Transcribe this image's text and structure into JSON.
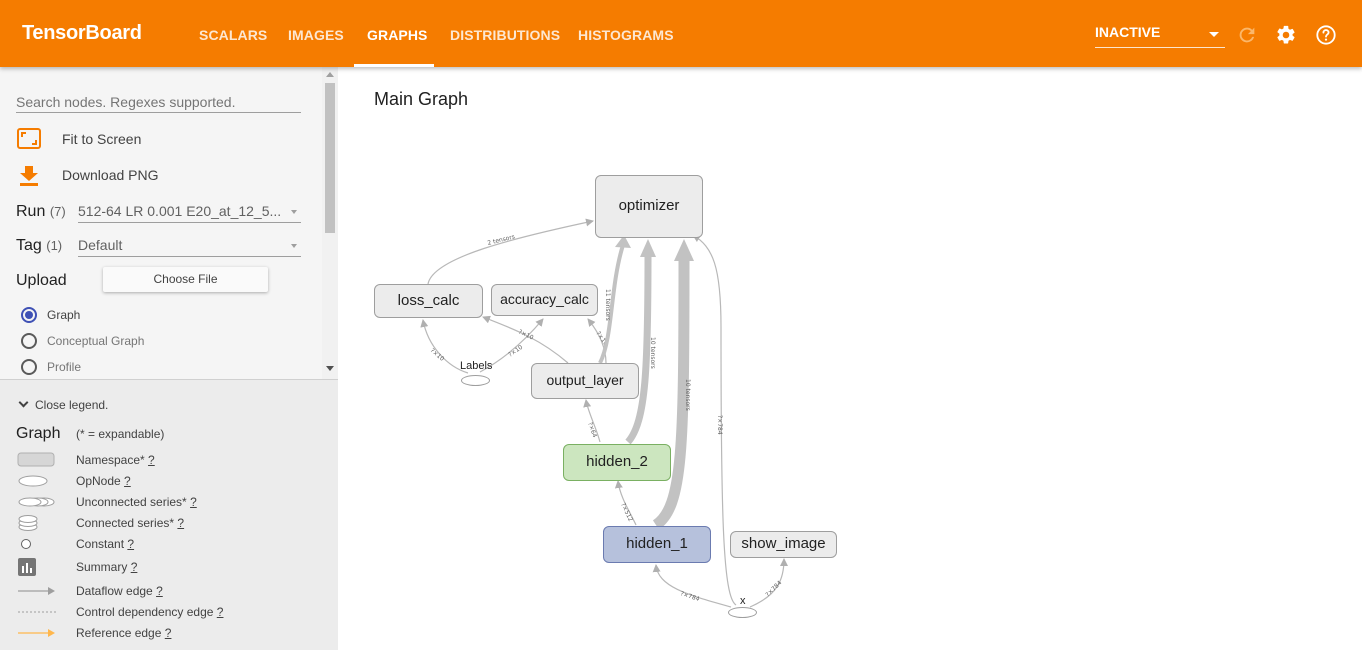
{
  "app": {
    "title": "TensorBoard",
    "tabs": [
      {
        "label": "SCALARS"
      },
      {
        "label": "IMAGES"
      },
      {
        "label": "GRAPHS"
      },
      {
        "label": "DISTRIBUTIONS"
      },
      {
        "label": "HISTOGRAMS"
      }
    ],
    "active_tab": "GRAPHS",
    "status_select": "INACTIVE",
    "icons": [
      "refresh-icon",
      "settings-icon",
      "help-icon"
    ],
    "accent_color": "#f57c00"
  },
  "sidebar": {
    "search_placeholder": "Search nodes. Regexes supported.",
    "fit_label": "Fit to Screen",
    "download_label": "Download PNG",
    "run": {
      "label": "Run",
      "count": "(7)",
      "value": "512-64 LR 0.001 E20_at_12_5..."
    },
    "tag": {
      "label": "Tag",
      "count": "(1)",
      "value": "Default"
    },
    "upload": {
      "label": "Upload",
      "button": "Choose File"
    },
    "radios": [
      {
        "label": "Graph",
        "checked": true
      },
      {
        "label": "Conceptual Graph",
        "checked": false
      },
      {
        "label": "Profile",
        "checked": false
      }
    ]
  },
  "legend": {
    "toggle_label": "Close legend.",
    "title": "Graph",
    "note": "(* = expandable)",
    "items": [
      {
        "label": "Namespace*",
        "help": "?"
      },
      {
        "label": "OpNode",
        "help": "?"
      },
      {
        "label": "Unconnected series*",
        "help": "?"
      },
      {
        "label": "Connected series*",
        "help": "?"
      },
      {
        "label": "Constant",
        "help": "?"
      },
      {
        "label": "Summary",
        "help": "?"
      },
      {
        "label": "Dataflow edge",
        "help": "?"
      },
      {
        "label": "Control dependency edge",
        "help": "?"
      },
      {
        "label": "Reference edge",
        "help": "?"
      }
    ]
  },
  "main": {
    "title": "Main Graph",
    "nodes": {
      "optimizer": "optimizer",
      "loss_calc": "loss_calc",
      "accuracy_calc": "accuracy_calc",
      "output_layer": "output_layer",
      "hidden_2": "hidden_2",
      "hidden_1": "hidden_1",
      "show_image": "show_image",
      "labels": "Labels",
      "x": "x"
    },
    "edge_labels": {
      "loss_to_opt": "2 tensors",
      "out_to_opt": "11 tensors",
      "h2_to_opt": "10 tensors",
      "h1_to_opt": "10 tensors",
      "x_to_opt": "?×784",
      "labels_to_loss": "?×10",
      "out_to_loss": "?×10",
      "labels_to_acc": "?×10",
      "out_to_acc": "?×10",
      "h2_to_out": "?×64",
      "h1_to_h2": "?×512",
      "x_to_h1": "?×784",
      "x_to_show": "?×784"
    }
  }
}
